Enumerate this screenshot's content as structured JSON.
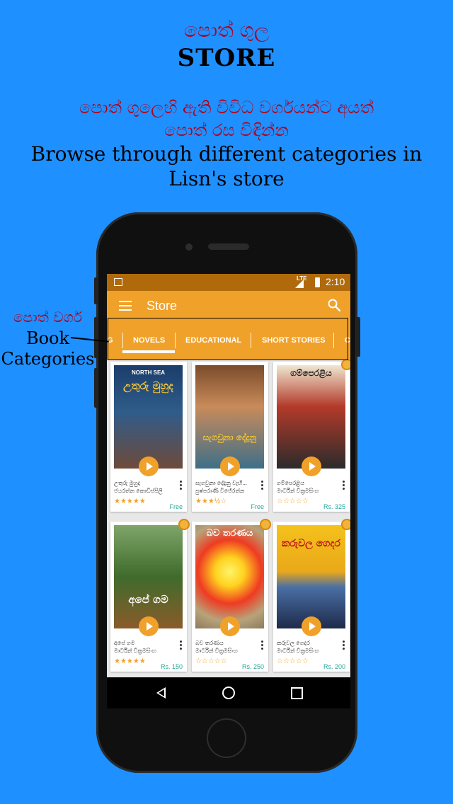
{
  "header": {
    "title_si": "පොත් ගුල",
    "title_en": "STORE",
    "desc_si_line1": "පොත් ගුලෙහි ඇති විවිධ වර්ගයන්ට අයත්",
    "desc_si_line2": "පොත් රස විඳින්න",
    "desc_en_line1": "Browse through different categories in",
    "desc_en_line2": "Lisn's store"
  },
  "callout": {
    "label_si": "පොත් වර්ග",
    "label_en_line1": "Book",
    "label_en_line2": "Categories"
  },
  "status_bar": {
    "network": "LTE",
    "time": "2:10"
  },
  "app_bar": {
    "title": "Store"
  },
  "tabs": {
    "items": [
      "G",
      "NOVELS",
      "EDUCATIONAL",
      "SHORT STORIES",
      "C"
    ],
    "selected": "NOVELS"
  },
  "books": [
    {
      "cover_title": "උතුරු මුහුද",
      "cover_author": "NORTH SEA",
      "title": "උතුරු මුහුද",
      "author": "ජයරත්න කොඩිප්පිලි",
      "rating": "★★★★★",
      "price": "Free",
      "award": false
    },
    {
      "cover_title": "සැගවුනා දේදුනු",
      "cover_author": "",
      "title": "සැගවුනා දේදුනු වැහි...",
      "author": "පුෂ්පරාණි විජේරත්න",
      "rating": "★★★½☆",
      "price": "Free",
      "award": false
    },
    {
      "cover_title": "ගම්පෙරළිය",
      "cover_author": "",
      "title": "ගම්පෙරළිය",
      "author": "මාර්ටින් වික්‍රමසිංහ",
      "rating": "☆☆☆☆☆",
      "price": "Rs. 325",
      "award": true
    },
    {
      "cover_title": "අපේ ගම",
      "cover_author": "",
      "title": "අපේ ගම",
      "author": "මාර්ටින් වික්‍රමසිංහ",
      "rating": "★★★★★",
      "price": "Rs. 150",
      "award": true
    },
    {
      "cover_title": "බව තරණය",
      "cover_author": "",
      "title": "බව තරණය",
      "author": "මාර්ටින් වික්‍රමසිංහ",
      "rating": "☆☆☆☆☆",
      "price": "Rs. 250",
      "award": true
    },
    {
      "cover_title": "කරුවල ගෙදර",
      "cover_author": "",
      "title": "කරුවල ගෙදර",
      "author": "මාර්ටින් වික්‍රමසිංහ",
      "rating": "☆☆☆☆☆",
      "price": "Rs. 200",
      "award": true
    }
  ],
  "colors": {
    "background": "#1e90ff",
    "accent": "#f0a12a",
    "status_bar": "#b06a0b",
    "heading_red": "#b3001b",
    "price_teal": "#26a69a"
  },
  "icons": {
    "menu": "menu-icon",
    "search": "search-icon",
    "play": "play-icon",
    "more": "more-vert-icon",
    "back": "back-icon",
    "home": "home-icon",
    "recents": "recents-icon"
  }
}
